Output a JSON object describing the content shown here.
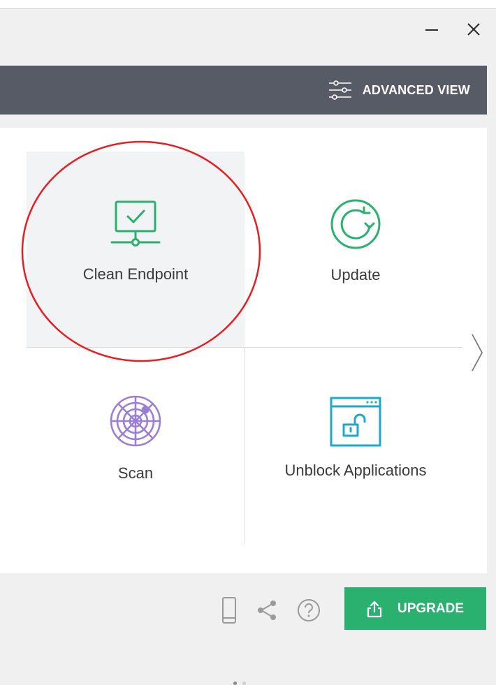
{
  "window": {
    "minimize_icon": "minimize-icon",
    "close_icon": "close-icon"
  },
  "header": {
    "advanced_view_label": "ADVANCED VIEW",
    "advanced_view_icon": "sliders-icon",
    "bar_color": "#575b66"
  },
  "tiles": [
    {
      "label": "Clean Endpoint",
      "icon": "monitor-check-icon",
      "color": "#2ab170",
      "selected": true
    },
    {
      "label": "Update",
      "icon": "refresh-icon",
      "color": "#2ab170"
    },
    {
      "label": "Scan",
      "icon": "radar-icon",
      "color": "#9b7fd4"
    },
    {
      "label": "Unblock Applications",
      "icon": "window-unlock-icon",
      "color": "#1fa9c6"
    }
  ],
  "pagination": {
    "current_page": 1,
    "total_pages": 2
  },
  "footer": {
    "mobile_icon": "mobile-icon",
    "share_icon": "share-icon",
    "help_icon": "help-icon",
    "upgrade_label": "UPGRADE",
    "upgrade_icon": "upload-icon",
    "upgrade_color": "#2ab170"
  },
  "annotation_color": "#e31e24"
}
